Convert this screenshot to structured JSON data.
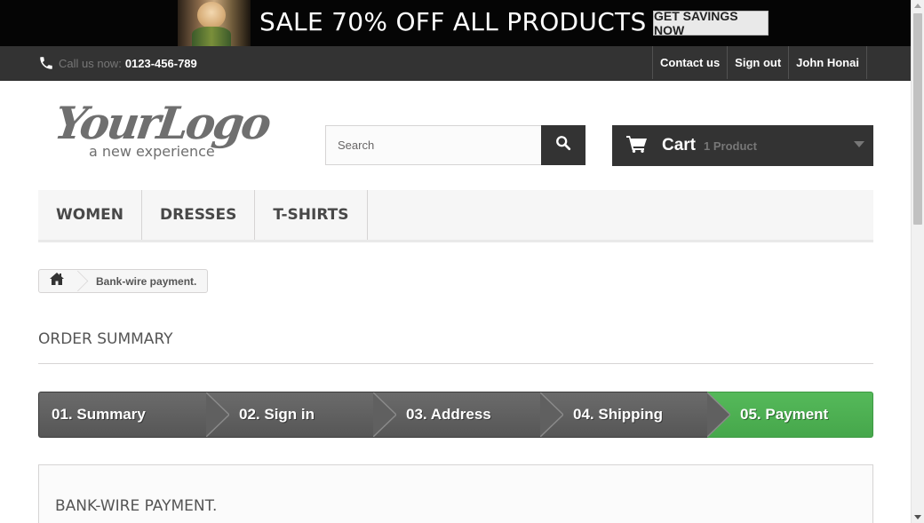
{
  "banner": {
    "headline": "SALE 70% OFF ALL PRODUCTS",
    "cta_label": "GET SAVINGS NOW"
  },
  "topbar": {
    "call_label": "Call us now:",
    "phone_number": "0123-456-789",
    "links": [
      {
        "label": "Contact us"
      },
      {
        "label": "Sign out"
      },
      {
        "label": "John Honai"
      }
    ]
  },
  "logo": {
    "text": "YourLogo",
    "tagline": "a new experience"
  },
  "search": {
    "placeholder": "Search",
    "value": ""
  },
  "cart": {
    "label": "Cart",
    "quantity": "1 Product"
  },
  "menu": {
    "items": [
      {
        "label": "Women"
      },
      {
        "label": "Dresses"
      },
      {
        "label": "T-shirts"
      }
    ]
  },
  "breadcrumb": {
    "current": "Bank-wire payment."
  },
  "page": {
    "heading": "Order summary"
  },
  "steps": [
    {
      "label": "01. Summary",
      "state": "done"
    },
    {
      "label": "02. Sign in",
      "state": "done"
    },
    {
      "label": "03. Address",
      "state": "done"
    },
    {
      "label": "04. Shipping",
      "state": "done"
    },
    {
      "label": "05. Payment",
      "state": "current"
    }
  ],
  "payment_box": {
    "title": "Bank-wire payment."
  },
  "colors": {
    "dark": "#333333",
    "step_gray": "#5e5e5e",
    "step_active": "#4cb051"
  }
}
